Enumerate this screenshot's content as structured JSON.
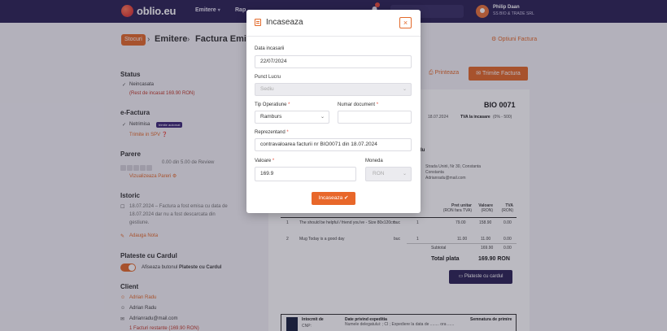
{
  "nav": {
    "brand": "oblio.eu",
    "links": [
      {
        "label": "Emitere"
      },
      {
        "label": "Rap"
      }
    ],
    "notifications": "1",
    "search_text": "...",
    "user_name": "Philip Daan",
    "user_company": "SS BIO & TRADE SRL"
  },
  "breadcrumb": {
    "badge": "Stocuri",
    "items": [
      "Emitere",
      "Factura Emisa"
    ],
    "options": "Optiuni Factura"
  },
  "left": {
    "status_heading": "Status",
    "status_value": "Neincasata",
    "status_rest": "(Rest de incasat 169.90 RON)",
    "efactura_heading": "e-Factura",
    "efactura_value": "Netrimisa",
    "efactura_pill": "trimite automat",
    "efactura_link": "Trimite in SPV",
    "parere_heading": "Parere",
    "parere_text": "0.00 din 5.00 de Review",
    "parere_link": "Vizualizeaza Pareri",
    "istoric_heading": "Istoric",
    "istoric_lines": [
      "18.07.2024 – Factura a fost emisa cu data de",
      "18.07.2024 dar nu a fost descarcata din",
      "gestiune."
    ],
    "istoric_link": "Adauga Nota",
    "card_heading": "Plateste cu Cardul",
    "card_text_prefix": "Afiseaza butonul",
    "card_text_bold": "Plateste cu Cardul",
    "client_heading": "Client",
    "client_name_link": "Adrian Radu",
    "client_name": "Adrian Radu",
    "client_email": "Adrianradu@mail.com",
    "client_extra": "1 Facturi restante (169.90 RON)"
  },
  "actions": {
    "print": "Printeaza",
    "send": "Trimite Factura"
  },
  "invoice": {
    "title": "a",
    "number": "BIO 0071",
    "date_small": "18.07.2024",
    "vat_label": "TVA la incasare",
    "vat_small": "(0% - 500)",
    "client_title": "du",
    "client_address_1": "Strada Unirii, Nr 30, Constanta",
    "client_address_2": "Constanta",
    "client_email": "Adrianradu@mail.com",
    "col_price": "Pret unitar",
    "col_price_sub": "(RON fara TVA)",
    "col_value": "Valoare",
    "col_value_sub": "(RON)",
    "col_vat": "TVA",
    "col_vat_sub": "(RON)",
    "rows": [
      {
        "no": "1",
        "name": "The should be helpful / friend you've - Size 80x120cm",
        "unit": "buc",
        "qty": "1",
        "price": "79.00",
        "value": "158.90",
        "vat": "0.00"
      },
      {
        "no": "2",
        "name": "Mug Today is a good day",
        "unit": "buc",
        "qty": "1",
        "price": "11.00",
        "value": "11.00",
        "vat": "0.00"
      }
    ],
    "subtotal_label": "Subtotal",
    "subtotal_value": "169.90",
    "subtotal_vat": "0.00",
    "total_label": "Total plata",
    "total_value": "169.90 RON",
    "pay_button": "Plateste cu cardul",
    "footer_col1": "Intocmit de",
    "footer_col2": "Date privind expeditia",
    "footer_col2_line": "Numele delegatului: ; CI ; Expediere la data de ........ ora ......",
    "footer_col3": "Semnatura de primire",
    "footer_cnp": "CNP:"
  },
  "modal": {
    "title": "Incaseaza",
    "close": "×",
    "date_label": "Data incasarii",
    "date_value": "22/07/2024",
    "punct_label": "Punct Lucru",
    "punct_value": "Sediu",
    "tip_label": "Tip Operatiune",
    "tip_value": "Ramburs",
    "nr_label": "Numar document",
    "nr_value": "",
    "rep_label": "Reprezentand",
    "rep_value": "contravaloarea facturii nr BIO0071 din 18.07.2024",
    "valoare_label": "Valoare",
    "valoare_value": "169.9",
    "moneda_label": "Moneda",
    "moneda_value": "RON",
    "submit": "Incaseaza"
  },
  "colors": {
    "brand_dark": "#2d2456",
    "accent": "#e36a2b"
  }
}
